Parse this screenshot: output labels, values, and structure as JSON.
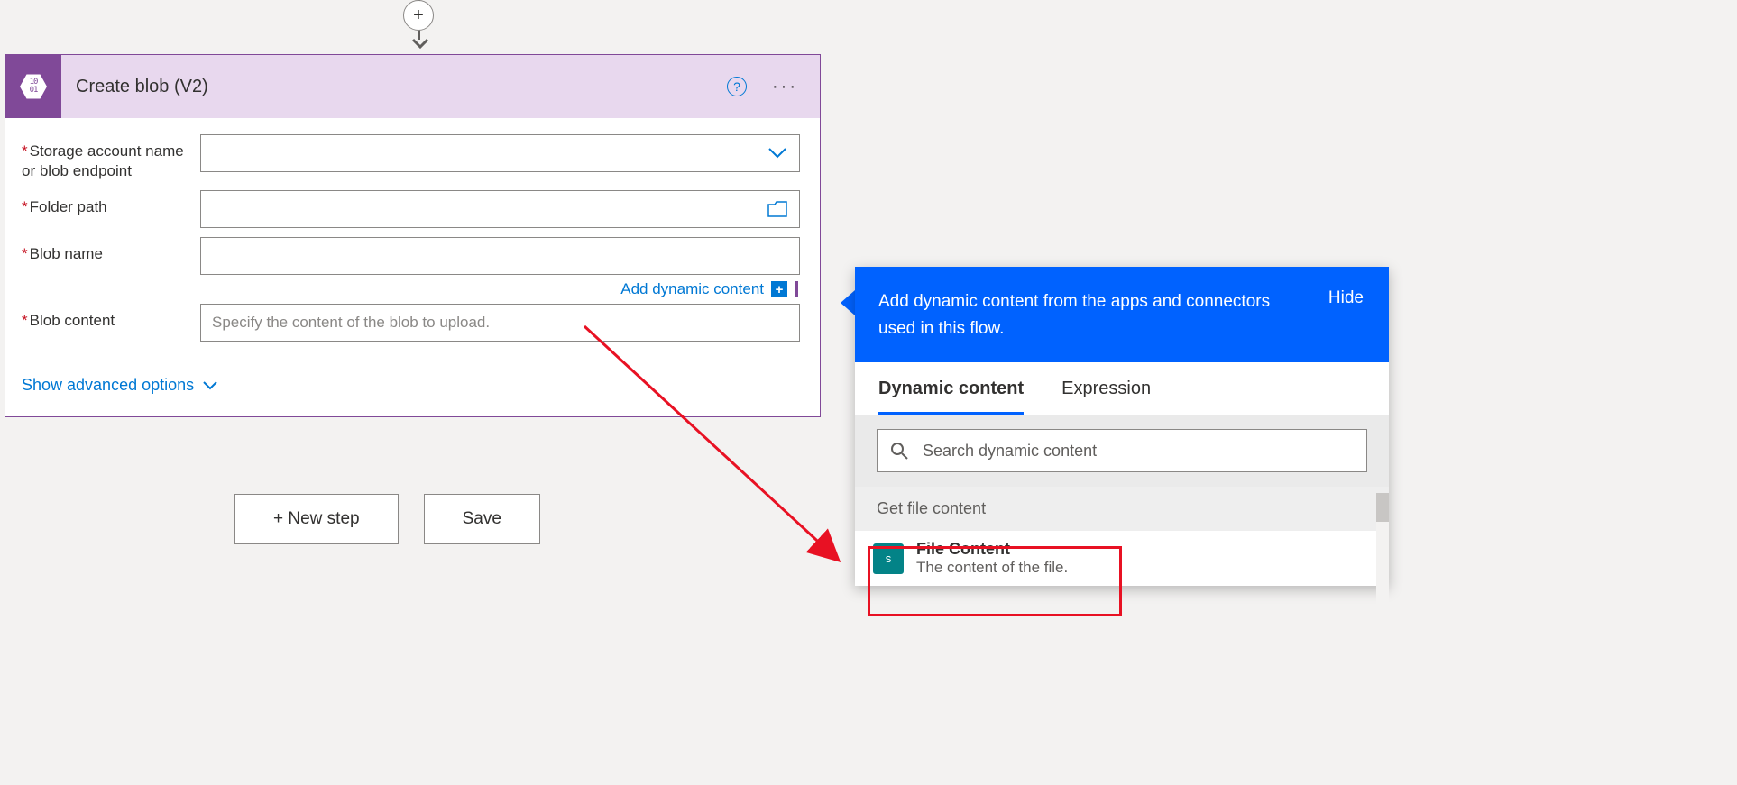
{
  "connector": {
    "plus_label": "+"
  },
  "card": {
    "title": "Create blob (V2)",
    "fields": {
      "storage": {
        "label": "Storage account name or blob endpoint"
      },
      "folder": {
        "label": "Folder path"
      },
      "blobname": {
        "label": "Blob name"
      },
      "content": {
        "label": "Blob content",
        "placeholder": "Specify the content of the blob to upload."
      }
    },
    "add_dynamic_link": "Add dynamic content",
    "advanced_link": "Show advanced options"
  },
  "buttons": {
    "new_step": "+ New step",
    "save": "Save"
  },
  "flyout": {
    "header_text": "Add dynamic content from the apps and connectors used in this flow.",
    "hide_label": "Hide",
    "tabs": {
      "dynamic": "Dynamic content",
      "expression": "Expression"
    },
    "search_placeholder": "Search dynamic content",
    "group_title": "Get file content",
    "item": {
      "name": "File Content",
      "desc": "The content of the file."
    }
  }
}
